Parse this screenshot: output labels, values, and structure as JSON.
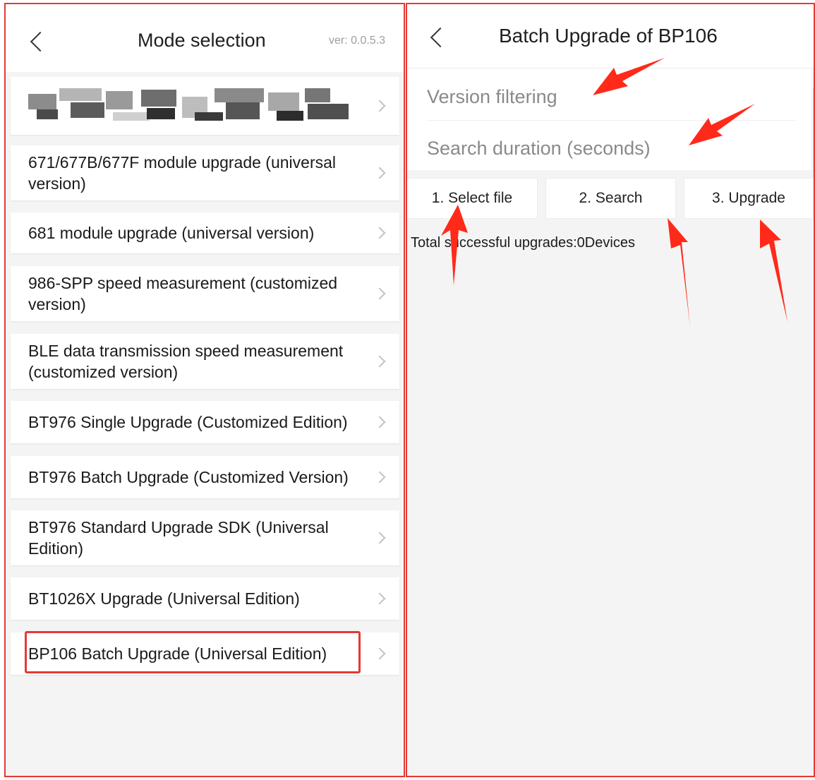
{
  "left_screen": {
    "title": "Mode selection",
    "version": "ver: 0.0.5.3",
    "items": [
      {
        "label": ""
      },
      {
        "label": "671/677B/677F module upgrade (universal version)"
      },
      {
        "label": "681 module upgrade (universal version)"
      },
      {
        "label": "986-SPP speed measurement (customized version)"
      },
      {
        "label": "BLE data transmission speed measurement (customized version)"
      },
      {
        "label": "BT976 Single Upgrade (Customized Edition)"
      },
      {
        "label": "BT976 Batch Upgrade (Customized Version)"
      },
      {
        "label": "BT976 Standard Upgrade SDK (Universal Edition)"
      },
      {
        "label": "BT1026X Upgrade (Universal Edition)"
      },
      {
        "label": "BP106 Batch Upgrade (Universal Edition)"
      }
    ]
  },
  "right_screen": {
    "title": "Batch Upgrade of BP106",
    "version_filter_placeholder": "Version filtering",
    "search_duration_placeholder": "Search duration (seconds)",
    "buttons": {
      "select_file": "1. Select file",
      "search": "2. Search",
      "upgrade": "3. Upgrade"
    },
    "status": "Total successful upgrades:0Devices"
  },
  "colors": {
    "annotation": "#e53935",
    "background": "#f4f4f4"
  }
}
